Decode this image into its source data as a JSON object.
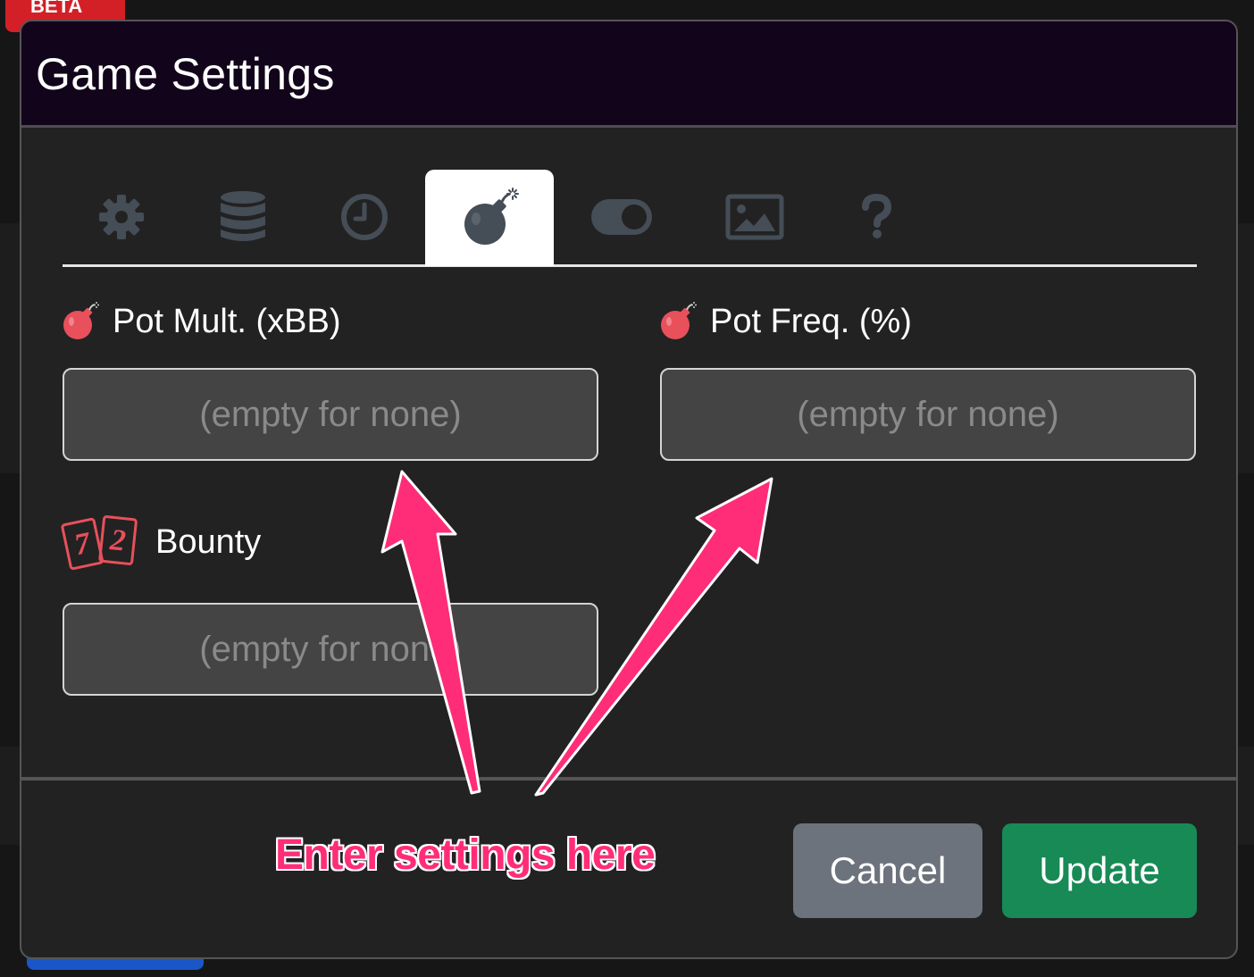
{
  "badge": {
    "beta_label": "BETA"
  },
  "modal": {
    "title": "Game Settings",
    "tabs": [
      {
        "icon": "gear-icon",
        "active": false
      },
      {
        "icon": "database-icon",
        "active": false
      },
      {
        "icon": "clock-icon",
        "active": false
      },
      {
        "icon": "bomb-icon",
        "active": true
      },
      {
        "icon": "toggle-icon",
        "active": false
      },
      {
        "icon": "image-icon",
        "active": false
      },
      {
        "icon": "question-icon",
        "active": false
      }
    ],
    "fields": {
      "pot_mult": {
        "label": "Pot Mult. (xBB)",
        "icon": "bomb-icon",
        "value": "",
        "placeholder": "(empty for none)"
      },
      "pot_freq": {
        "label": "Pot Freq. (%)",
        "icon": "bomb-icon",
        "value": "",
        "placeholder": "(empty for none)"
      },
      "bounty": {
        "label": "Bounty",
        "icon": "cards-72-icon",
        "card_left": "7",
        "card_right": "2",
        "value": "",
        "placeholder": "(empty for none)"
      }
    },
    "buttons": {
      "cancel": "Cancel",
      "update": "Update"
    }
  },
  "annotation": {
    "text": "Enter settings here",
    "color": "#ff2d78"
  },
  "colors": {
    "accent_red": "#e8505b",
    "update_green": "#178a55",
    "cancel_gray": "#6c737d"
  }
}
